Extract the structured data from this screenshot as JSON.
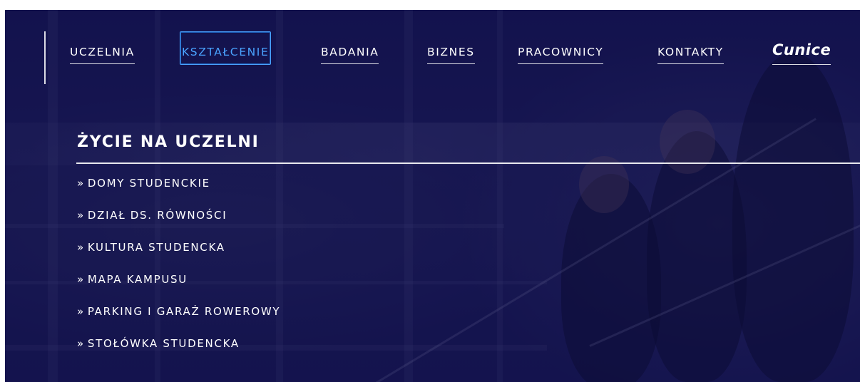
{
  "nav": {
    "items": [
      {
        "label": "UCZELNIA",
        "active": false
      },
      {
        "label": "KSZTAŁCENIE",
        "active": true
      },
      {
        "label": "BADANIA",
        "active": false
      },
      {
        "label": "BIZNES",
        "active": false
      },
      {
        "label": "PRACOWNICY",
        "active": false
      },
      {
        "label": "KONTAKTY",
        "active": false
      }
    ],
    "logo": "Cunice",
    "active_color": "#4aa3ff"
  },
  "section": {
    "title": "ŻYCIE NA UCZELNI",
    "link_marker": "»",
    "links": [
      "DOMY STUDENCKIE",
      "DZIAŁ DS. RÓWNOŚCI",
      "KULTURA STUDENCKA",
      "MAPA KAMPUSU",
      "PARKING I GARAŻ ROWEROWY",
      "STOŁÓWKA STUDENCKA"
    ]
  },
  "colors": {
    "overlay": "#14124a",
    "text": "#ffffff"
  }
}
